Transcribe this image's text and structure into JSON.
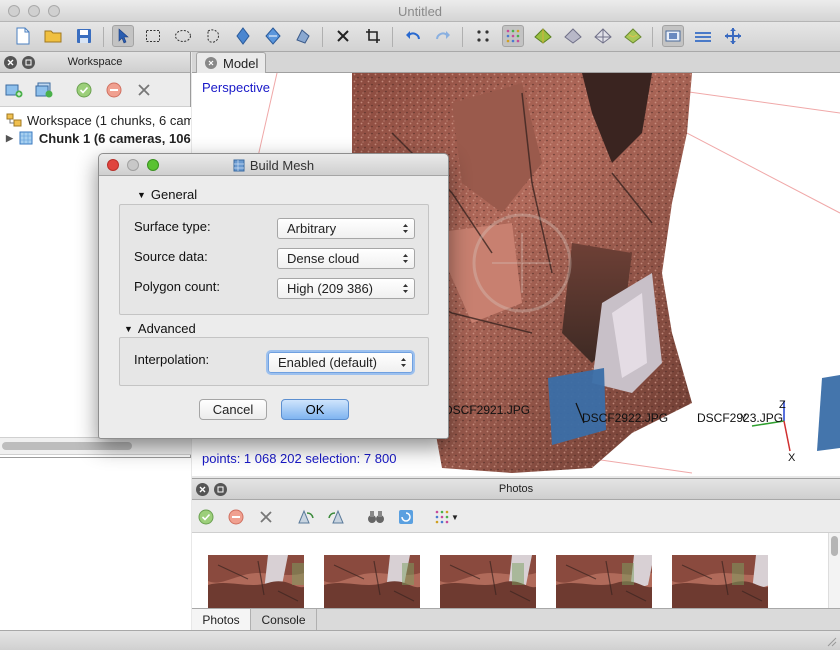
{
  "window": {
    "title": "Untitled"
  },
  "workspace": {
    "title": "Workspace",
    "root_label": "Workspace (1 chunks, 6 cameras)",
    "chunk_label": "Chunk 1 (6 cameras, 1068202 points)"
  },
  "model": {
    "tab_label": "Model",
    "view_mode": "Perspective",
    "stats": "points: 1 068 202 selection: 7 800",
    "camera_labels": [
      "DSCF2921.JPG",
      "DSCF2922.JPG",
      "DSCF2923.JPG"
    ],
    "axis_labels": {
      "z": "Z",
      "y": "Y",
      "x": "X"
    }
  },
  "photos": {
    "title": "Photos",
    "tabs": [
      "Photos",
      "Console"
    ],
    "active_tab": "Photos",
    "thumbnail_count": 5
  },
  "dialog": {
    "title": "Build Mesh",
    "general_label": "General",
    "advanced_label": "Advanced",
    "surface_type_label": "Surface type:",
    "surface_type_value": "Arbitrary",
    "source_data_label": "Source data:",
    "source_data_value": "Dense cloud",
    "polygon_count_label": "Polygon count:",
    "polygon_count_value": "High (209 386)",
    "interpolation_label": "Interpolation:",
    "interpolation_value": "Enabled (default)",
    "cancel_label": "Cancel",
    "ok_label": "OK"
  },
  "colors": {
    "accent_blue": "#1818c8",
    "camera_blue": "#3a6ea8",
    "rock_red": "#a0493a"
  },
  "toolbar_icons": [
    "new-document-icon",
    "open-folder-icon",
    "save-icon",
    "pointer-icon",
    "rectangle-select-icon",
    "circle-select-icon",
    "free-select-icon",
    "navigation-icon",
    "rotate-icon",
    "resize-icon",
    "delete-icon",
    "crop-icon",
    "undo-icon",
    "redo-icon",
    "point-cloud-icon",
    "dense-cloud-icon",
    "shaded-model-icon",
    "solid-model-icon",
    "wireframe-model-icon",
    "textured-model-icon",
    "show-cameras-icon",
    "show-region-icon",
    "reset-view-icon"
  ]
}
